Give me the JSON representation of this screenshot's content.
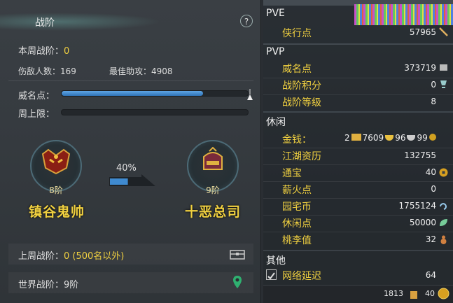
{
  "left": {
    "title": "战阶",
    "help": "?",
    "weekly_rank_label": "本周战阶：",
    "weekly_rank_value": "0",
    "kills_text": "伤敌人数：169",
    "assist_text": "最佳助攻：4908",
    "prestige_label": "威名点：",
    "prestige_progress": 0.76,
    "weekly_cap_label": "周上限：",
    "weekly_cap_progress": 0,
    "current_rank": {
      "level": "8阶",
      "name": "镇谷鬼帅"
    },
    "next_rank": {
      "level": "9阶",
      "name": "十恶总司"
    },
    "progress_pct": "40%",
    "progress_fraction": 0.4,
    "last_week_label": "上周战阶：",
    "last_week_value": "0 (500名以外)",
    "world_rank_text": "世界战阶：9阶"
  },
  "right": {
    "pve": {
      "title": "PVE",
      "items": [
        {
          "label": "侠行点",
          "value": "57965",
          "icon": "brush-icon"
        }
      ]
    },
    "pvp": {
      "title": "PVP",
      "items": [
        {
          "label": "威名点",
          "value": "373719",
          "icon": "badge-icon"
        },
        {
          "label": "战阶积分",
          "value": "0",
          "icon": "trophy-icon"
        },
        {
          "label": "战阶等级",
          "value": "8",
          "icon": ""
        }
      ]
    },
    "leisure": {
      "title": "休闲",
      "money_label": "金钱：",
      "money": [
        {
          "value": "2",
          "icon": "gold-ingot-icon"
        },
        {
          "value": "7609",
          "icon": "gold-sycee-icon"
        },
        {
          "value": "96",
          "icon": "silver-sycee-icon"
        },
        {
          "value": "99",
          "icon": "copper-coin-icon"
        }
      ],
      "items": [
        {
          "label": "江湖资历",
          "value": "132755",
          "icon": ""
        },
        {
          "label": "通宝",
          "value": "40",
          "icon": "coin-icon"
        },
        {
          "label": "薪火点",
          "value": "0",
          "icon": ""
        },
        {
          "label": "园宅币",
          "value": "1755124",
          "icon": "swirl-icon"
        },
        {
          "label": "休闲点",
          "value": "50000",
          "icon": "leaf-icon"
        },
        {
          "label": "桃李值",
          "value": "32",
          "icon": "gourd-icon"
        }
      ]
    },
    "other": {
      "title": "其他",
      "items": [
        {
          "label": "网络延迟",
          "value": "64",
          "checked": true
        }
      ]
    },
    "bottom": {
      "count1": "1813",
      "count2": "40"
    }
  },
  "colors": {
    "accent_yellow": "#f0d040",
    "bar_blue": "#3f8ad0"
  }
}
